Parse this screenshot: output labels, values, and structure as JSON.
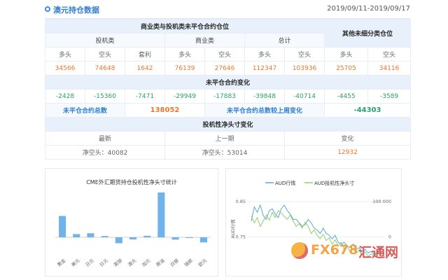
{
  "header": {
    "title": "澳元持仓数据",
    "date_range": "2019/09/11-2019/09/17",
    "icon": "circle-icon"
  },
  "colors": {
    "accent": "#2f7fd3",
    "orange": "#f0752b",
    "green": "#2aa06c",
    "header_bg": "#e8f1fb",
    "bar": "#6fb3ea",
    "line_aud": "#5aa5e0",
    "line_net": "#8fd06a"
  },
  "table": {
    "group_header": "商业类与投机类未平仓合约仓位",
    "other_header": "其他未细分类仓位",
    "sub_headers": {
      "spec": "投机类",
      "comm": "商业类",
      "total": "总计"
    },
    "col_labels": [
      "多头",
      "空头",
      "套利",
      "多头",
      "空头",
      "多头",
      "空头",
      "多头",
      "空头"
    ],
    "positions": [
      "34566",
      "74648",
      "1642",
      "76139",
      "27646",
      "112347",
      "103936",
      "25705",
      "34116"
    ],
    "change_header": "未平仓合约变化",
    "changes": [
      "-2428",
      "-15360",
      "-7471",
      "-29949",
      "-17883",
      "-39848",
      "-40714",
      "-4455",
      "-3589"
    ],
    "oi_total_label": "未平仓合约总数",
    "oi_total_value": "138052",
    "oi_weekly_label": "未平仓合约总数较上周变化",
    "oi_weekly_value": "-44303",
    "net_header": "投机性净头寸变化",
    "net_cols": [
      "最新",
      "上一期",
      "变化"
    ],
    "net_latest": "净空头：40082",
    "net_prev": "净空头：53014",
    "net_change": "12932"
  },
  "bar_chart_title": "CME外汇期货持仓投机性净头寸统计",
  "line_chart_legend": [
    "AUD行情",
    "AUD投机性净头寸"
  ],
  "watermark": {
    "brand": "FX678",
    "cn": "汇通网"
  },
  "chart_data": [
    {
      "type": "bar",
      "title": "CME外汇期货持仓投机性净头寸统计",
      "categories": [
        "黄金",
        "美元",
        "日元",
        "日元",
        "英镑",
        "澳元",
        "加元",
        "原油",
        "白银",
        "瑞郎",
        "欧元"
      ],
      "values": [
        100,
        15,
        19,
        6,
        -28,
        -10,
        7,
        210,
        -11,
        -1,
        -24
      ],
      "grid": false,
      "y_visible": false
    },
    {
      "type": "line",
      "legend": [
        "AUD行情",
        "AUD投机性净头寸"
      ],
      "legend_position": "top",
      "ylabel_left": "AUD行情",
      "yticks_left": [
        "0.85",
        "0.75"
      ],
      "yticks_right": [
        "100 000",
        "0"
      ],
      "series": [
        {
          "name": "AUD行情",
          "axis": "left",
          "values": [
            0.795,
            0.835,
            0.82,
            0.84,
            0.81,
            0.8,
            0.825,
            0.83,
            0.815,
            0.805,
            0.83,
            0.84,
            0.825,
            0.815,
            0.8,
            0.8,
            0.79,
            0.78,
            0.785,
            0.8,
            0.79,
            0.775,
            0.77,
            0.76,
            0.775,
            0.76,
            0.755,
            0.745,
            0.755,
            0.735,
            0.73,
            0.735,
            0.725,
            0.72,
            0.73,
            0.715,
            0.72,
            0.71,
            0.715,
            0.705,
            0.71,
            0.7,
            0.705,
            0.72
          ]
        },
        {
          "name": "AUD投机性净头寸",
          "axis": "right",
          "values": [
            60000,
            40000,
            55000,
            30000,
            45000,
            62000,
            48000,
            70000,
            55000,
            75000,
            68000,
            58000,
            50000,
            62000,
            45000,
            30000,
            38000,
            25000,
            42000,
            30000,
            10000,
            20000,
            5000,
            -5000,
            8000,
            -10000,
            -2000,
            -20000,
            -8000,
            -25000,
            -15000,
            -35000,
            -28000,
            -40000,
            -32000,
            -45000,
            -38000,
            -50000,
            -42000,
            -55000,
            -48000,
            -53000,
            -45000,
            -40000
          ]
        }
      ]
    }
  ]
}
